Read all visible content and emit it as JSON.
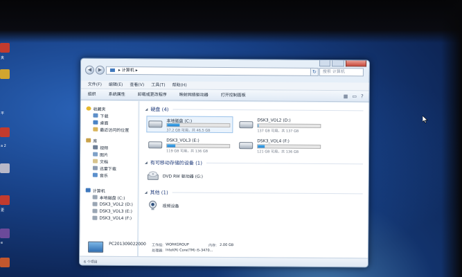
{
  "desktop": {
    "labels": [
      "夹",
      "平",
      "a 2",
      "更",
      "e"
    ]
  },
  "window": {
    "address_path": "计算机",
    "search_placeholder": "搜索 计算机",
    "menu": [
      "文件(F)",
      "编辑(E)",
      "查看(V)",
      "工具(T)",
      "帮助(H)"
    ],
    "toolbar": [
      "组织",
      "系统属性",
      "卸载或更改程序",
      "映射网络驱动器",
      "打开控制面板"
    ]
  },
  "navpane": {
    "favorites": {
      "label": "收藏夹",
      "items": [
        "下载",
        "桌面",
        "最近访问的位置"
      ]
    },
    "libraries": {
      "label": "库",
      "items": [
        "视频",
        "图片",
        "文档",
        "迅雷下载",
        "音乐"
      ]
    },
    "computer": {
      "label": "计算机",
      "items": [
        "本地磁盘 (C:)",
        "DSK3_VOL2 (D:)",
        "DSK3_VOL3 (E:)",
        "DSK3_VOL4 (F:)"
      ]
    }
  },
  "content": {
    "hard_disks": {
      "heading": "硬盘 (4)",
      "drives": [
        {
          "name": "本地磁盘 (C:)",
          "space": "37.2 GB 可用，共 46.5 GB",
          "used_fraction": 0.2
        },
        {
          "name": "DSK3_VOL2 (D:)",
          "space": "137 GB 可用，共 137 GB",
          "used_fraction": 0.01
        },
        {
          "name": "DSK3_VOL3 (E:)",
          "space": "119 GB 可用，共 136 GB",
          "used_fraction": 0.13
        },
        {
          "name": "DSK3_VOL4 (F:)",
          "space": "121 GB 可用，共 136 GB",
          "used_fraction": 0.11
        }
      ]
    },
    "removable": {
      "heading": "有可移动存储的设备 (1)",
      "items": [
        "DVD RW 驱动器 (G:)"
      ]
    },
    "other": {
      "heading": "其他 (1)",
      "items": [
        "视频设备"
      ]
    }
  },
  "details": {
    "computer_name": "PC201309022000",
    "workgroup_label": "工作组:",
    "workgroup_value": "WORKGROUP",
    "memory_label": "内存:",
    "memory_value": "2.00 GB",
    "processor_label": "处理器:",
    "processor_value": "Intel(R) Core(TM) i5-3470..."
  },
  "status": {
    "item_count": "6 个项目"
  }
}
